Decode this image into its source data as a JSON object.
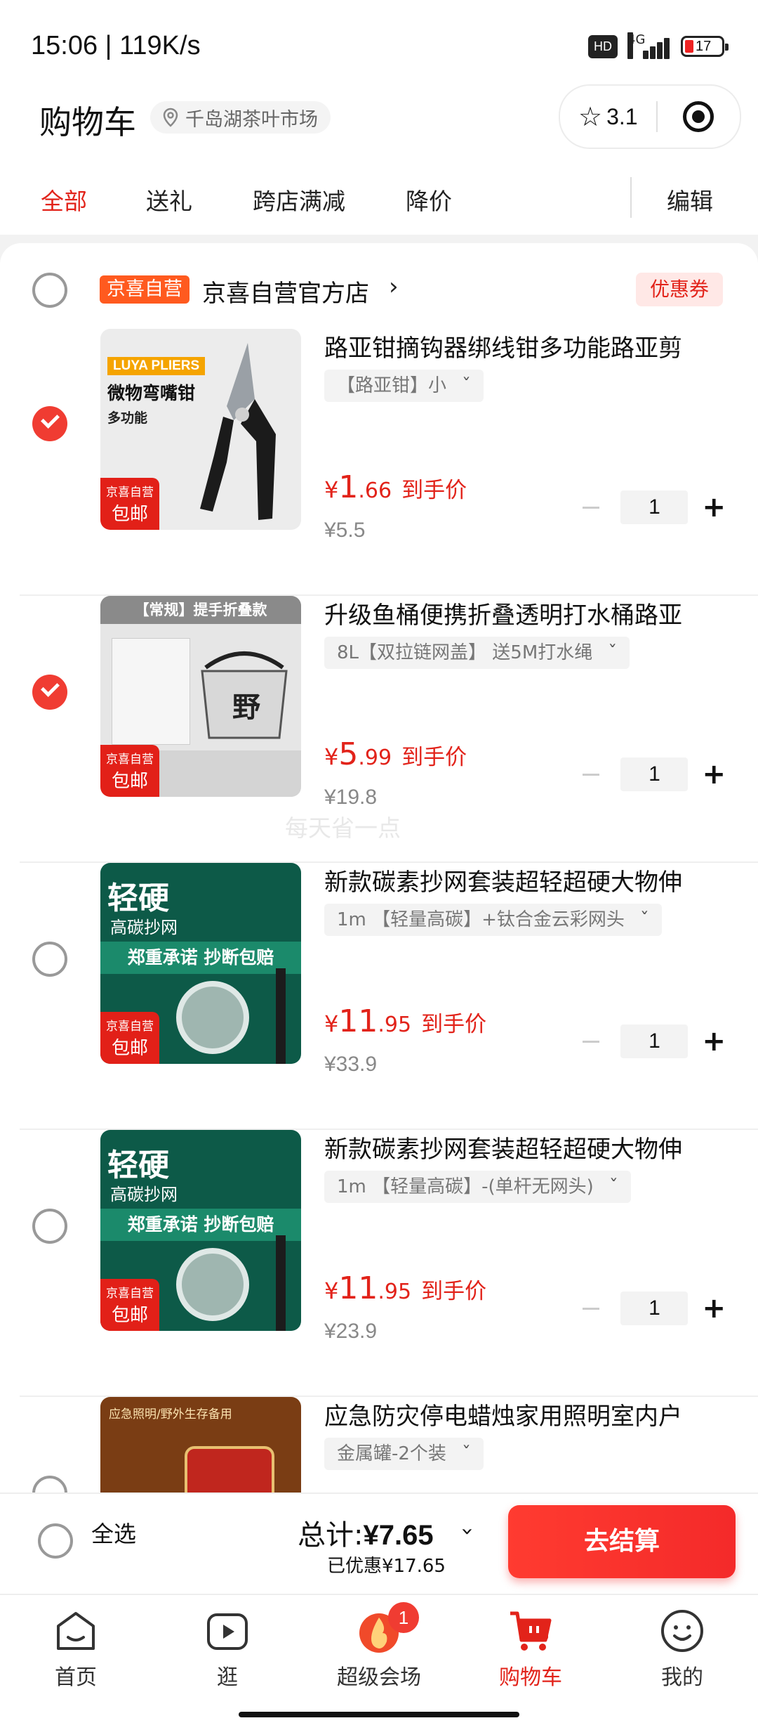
{
  "status_bar": {
    "time": "15:06 | 119K/s",
    "hd": "HD",
    "network": "4G",
    "battery": "17"
  },
  "header": {
    "title": "购物车",
    "location": "千岛湖茶叶市场",
    "rating": "3.1"
  },
  "tabs": [
    {
      "label": "全部",
      "active": true
    },
    {
      "label": "送礼",
      "active": false
    },
    {
      "label": "跨店满减",
      "active": false
    },
    {
      "label": "降价",
      "active": false
    }
  ],
  "edit_label": "编辑",
  "store": {
    "badge": "京喜自营",
    "name": "京喜自营官方店",
    "arrow": "›",
    "coupon": "优惠券"
  },
  "items": [
    {
      "name": "路亚钳摘钩器绑线钳多功能路亚剪",
      "sku": "【路亚钳】小",
      "price_currency": "¥",
      "price_int": "1",
      "price_dec": ".66",
      "price_label": "到手价",
      "original_price": "¥5.5",
      "quantity": "1",
      "checked": true,
      "tag_line1": "京喜自营",
      "tag_line2": "包邮",
      "thumb_text1": "LUYA PLIERS",
      "thumb_text2": "微物弯嘴钳",
      "thumb_text3": "多功能"
    },
    {
      "name": "升级鱼桶便携折叠透明打水桶路亚",
      "sku": "8L【双拉链网盖】 送5M打水绳",
      "price_currency": "¥",
      "price_int": "5",
      "price_dec": ".99",
      "price_label": "到手价",
      "original_price": "¥19.8",
      "quantity": "1",
      "checked": true,
      "tag_line1": "京喜自营",
      "tag_line2": "包邮",
      "thumb_text1": "【常规】提手折叠款"
    },
    {
      "name": "新款碳素抄网套装超轻超硬大物伸",
      "sku": "1m 【轻量高碳】+钛合金云彩网头",
      "price_currency": "¥",
      "price_int": "11",
      "price_dec": ".95",
      "price_label": "到手价",
      "original_price": "¥33.9",
      "quantity": "1",
      "checked": false,
      "tag_line1": "京喜自营",
      "tag_line2": "包邮",
      "thumb_text1": "轻硬",
      "thumb_text2": "高碳抄网",
      "thumb_text3": "郑重承诺 抄断包赔"
    },
    {
      "name": "新款碳素抄网套装超轻超硬大物伸",
      "sku": "1m 【轻量高碳】-(单杆无网头)",
      "price_currency": "¥",
      "price_int": "11",
      "price_dec": ".95",
      "price_label": "到手价",
      "original_price": "¥23.9",
      "quantity": "1",
      "checked": false,
      "tag_line1": "京喜自营",
      "tag_line2": "包邮",
      "thumb_text1": "轻硬",
      "thumb_text2": "高碳抄网",
      "thumb_text3": "郑重承诺 抄断包赔"
    },
    {
      "name": "应急防灾停电蜡烛家用照明室内户",
      "sku": "金属罐-2个装",
      "checked": false,
      "thumb_text1": "应急照明/野外生存备用"
    }
  ],
  "watermark": "每天省一点",
  "footer": {
    "select_all": "全选",
    "total_label": "总计:",
    "total_value": "¥7.65",
    "saved": "已优惠¥17.65",
    "checkout": "去结算"
  },
  "nav": [
    {
      "label": "首页",
      "icon": "home-icon"
    },
    {
      "label": "逛",
      "icon": "video-icon"
    },
    {
      "label": "超级会场",
      "icon": "flame-icon",
      "badge": "1"
    },
    {
      "label": "购物车",
      "icon": "cart-icon",
      "active": true
    },
    {
      "label": "我的",
      "icon": "smile-icon"
    }
  ],
  "colors": {
    "accent": "#e2231a",
    "checkout": "#f42a2a"
  }
}
